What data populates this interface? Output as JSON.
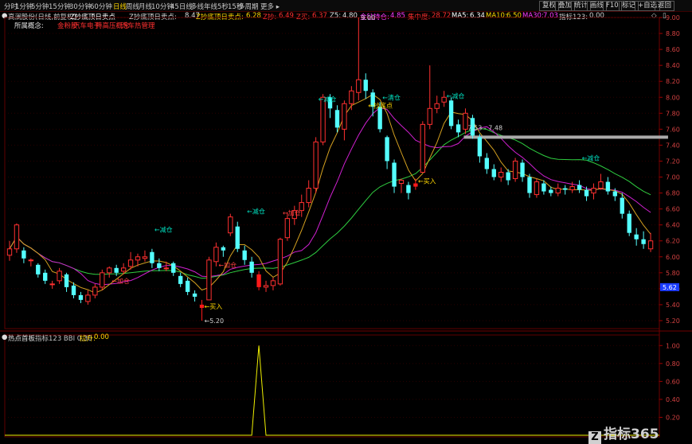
{
  "toolbar": {
    "tabs": [
      "分时",
      "1分钟",
      "5分钟",
      "15分钟",
      "30分钟",
      "60分钟",
      "日线",
      "周线",
      "月线",
      "10分钟",
      "45日线",
      "多线",
      "年线",
      "5秒",
      "15秒",
      "多周期",
      "更多 ▸"
    ],
    "active_index": 6,
    "right_buttons": [
      "复权",
      "叠加",
      "统计",
      "画线",
      "F10",
      "标记",
      "+自选",
      "返回"
    ]
  },
  "info": {
    "stock": "高澜股份(日线,前复权)",
    "indicator": "Z抄底顶日卖点",
    "v1_label": "Z抄底顶日卖点:",
    "v1": "8.47",
    "v2_label": "Z抄底顶日卖点:",
    "v2": "6.28",
    "v3_label": "Z抄:",
    "v3": "6.49",
    "v4_label": "Z买:",
    "v4": "6.37",
    "v5_label": "Z5:",
    "v5": "4.80",
    "v6_label": "金钻持仓:",
    "v6": "4.85",
    "v7_label": "集中度:",
    "v7": "28.72",
    "ma5_label": "MA5:",
    "ma5": "6.34",
    "ma10_label": "MA10:",
    "ma10": "6.50",
    "ma30_label": "MA30:",
    "ma30": "7.03",
    "sig_label": "指标123:",
    "sig": "0.00"
  },
  "tags": {
    "title": "所属概念:",
    "items": [
      "金粉股",
      "汽车电子",
      "特高压概念",
      "汽车热管理"
    ]
  },
  "indicator_panel": {
    "name": "热点首板",
    "params": "指标123 BBI 0.30",
    "param_label": "拉升:",
    "param_value": "0.00"
  },
  "watermark": "指标365",
  "chart_data": {
    "type": "candlestick",
    "y_ticks": [
      "9.00",
      "8.80",
      "8.60",
      "8.40",
      "8.20",
      "8.00",
      "7.80",
      "7.60",
      "7.40",
      "7.20",
      "7.00",
      "6.80",
      "6.60",
      "6.40",
      "6.20",
      "6.00",
      "5.80",
      "5.60",
      "5.40",
      "5.20"
    ],
    "ylim": [
      5.1,
      9.0
    ],
    "current_price": "5.62",
    "annotations": [
      {
        "text": "9.00",
        "i": 49,
        "price": 9.0
      },
      {
        "text": "←减仓",
        "i": 20,
        "price": 6.34
      },
      {
        "text": "←减仓",
        "i": 33,
        "price": 6.57
      },
      {
        "text": "←减仓",
        "i": 43,
        "price": 7.98
      },
      {
        "text": "←清仓",
        "i": 52,
        "price": 8.0
      },
      {
        "text": "←抄底点",
        "i": 50,
        "price": 7.9
      },
      {
        "text": "←减仓",
        "i": 61,
        "price": 8.02
      },
      {
        "text": "←减仓",
        "i": 80,
        "price": 7.24
      },
      {
        "text": "←加仓",
        "i": 29,
        "price": 5.9
      },
      {
        "text": "←加仓",
        "i": 38,
        "price": 6.55
      },
      {
        "text": "←加仓",
        "i": 14,
        "price": 5.7
      },
      {
        "text": "←买入",
        "i": 27,
        "price": 5.38
      },
      {
        "text": "←5.20",
        "i": 27,
        "price": 5.2
      },
      {
        "text": "←买入",
        "i": 57,
        "price": 6.95
      },
      {
        "text": "7.53 - 7.48",
        "i": 64,
        "price": 7.62
      }
    ],
    "candles": [
      {
        "o": 6.02,
        "c": 6.1,
        "h": 6.2,
        "l": 5.95
      },
      {
        "o": 6.1,
        "c": 6.4,
        "h": 6.42,
        "l": 6.05
      },
      {
        "o": 6.08,
        "c": 5.98,
        "h": 6.12,
        "l": 5.92
      },
      {
        "o": 5.96,
        "c": 5.96,
        "h": 5.98,
        "l": 5.88
      },
      {
        "o": 5.9,
        "c": 5.78,
        "h": 5.92,
        "l": 5.74
      },
      {
        "o": 5.8,
        "c": 5.7,
        "h": 5.84,
        "l": 5.66
      },
      {
        "o": 5.66,
        "c": 5.66,
        "h": 5.7,
        "l": 5.6
      },
      {
        "o": 5.7,
        "c": 5.82,
        "h": 5.86,
        "l": 5.66
      },
      {
        "o": 5.78,
        "c": 5.62,
        "h": 5.8,
        "l": 5.56
      },
      {
        "o": 5.64,
        "c": 5.52,
        "h": 5.68,
        "l": 5.48
      },
      {
        "o": 5.52,
        "c": 5.46,
        "h": 5.56,
        "l": 5.42
      },
      {
        "o": 5.44,
        "c": 5.52,
        "h": 5.58,
        "l": 5.4
      },
      {
        "o": 5.52,
        "c": 5.62,
        "h": 5.66,
        "l": 5.48
      },
      {
        "o": 5.62,
        "c": 5.8,
        "h": 5.84,
        "l": 5.58
      },
      {
        "o": 5.8,
        "c": 5.86,
        "h": 5.88,
        "l": 5.74
      },
      {
        "o": 5.86,
        "c": 5.8,
        "h": 5.9,
        "l": 5.76
      },
      {
        "o": 5.82,
        "c": 5.86,
        "h": 5.92,
        "l": 5.78
      },
      {
        "o": 5.88,
        "c": 5.96,
        "h": 6.06,
        "l": 5.84
      },
      {
        "o": 5.96,
        "c": 6.0,
        "h": 6.04,
        "l": 5.88
      },
      {
        "o": 5.98,
        "c": 6.0,
        "h": 6.08,
        "l": 5.94
      },
      {
        "o": 6.06,
        "c": 5.92,
        "h": 6.1,
        "l": 5.86
      },
      {
        "o": 5.92,
        "c": 5.86,
        "h": 5.98,
        "l": 5.82
      },
      {
        "o": 5.86,
        "c": 5.86,
        "h": 5.94,
        "l": 5.82
      },
      {
        "o": 5.92,
        "c": 5.8,
        "h": 5.94,
        "l": 5.76
      },
      {
        "o": 5.76,
        "c": 5.66,
        "h": 5.8,
        "l": 5.62
      },
      {
        "o": 5.7,
        "c": 5.56,
        "h": 5.74,
        "l": 5.52
      },
      {
        "o": 5.54,
        "c": 5.5,
        "h": 5.58,
        "l": 5.44
      },
      {
        "o": 5.36,
        "c": 5.4,
        "h": 5.46,
        "l": 5.2
      },
      {
        "o": 5.46,
        "c": 5.96,
        "h": 6.0,
        "l": 5.46
      },
      {
        "o": 5.94,
        "c": 6.12,
        "h": 6.18,
        "l": 5.88
      },
      {
        "o": 6.12,
        "c": 6.08,
        "h": 6.14,
        "l": 6.0
      },
      {
        "o": 6.3,
        "c": 6.5,
        "h": 6.54,
        "l": 6.26
      },
      {
        "o": 6.38,
        "c": 6.1,
        "h": 6.44,
        "l": 6.06
      },
      {
        "o": 6.08,
        "c": 5.96,
        "h": 6.14,
        "l": 5.9
      },
      {
        "o": 5.94,
        "c": 5.8,
        "h": 6.0,
        "l": 5.74
      },
      {
        "o": 5.78,
        "c": 5.62,
        "h": 5.82,
        "l": 5.58
      },
      {
        "o": 5.62,
        "c": 5.64,
        "h": 5.7,
        "l": 5.56
      },
      {
        "o": 5.64,
        "c": 5.7,
        "h": 5.74,
        "l": 5.58
      },
      {
        "o": 5.66,
        "c": 6.22,
        "h": 6.24,
        "l": 5.64
      },
      {
        "o": 6.24,
        "c": 6.48,
        "h": 6.56,
        "l": 6.2
      },
      {
        "o": 6.48,
        "c": 6.58,
        "h": 6.64,
        "l": 6.4
      },
      {
        "o": 6.58,
        "c": 6.68,
        "h": 6.78,
        "l": 6.5
      },
      {
        "o": 6.68,
        "c": 6.86,
        "h": 6.96,
        "l": 6.62
      },
      {
        "o": 6.86,
        "c": 7.44,
        "h": 7.5,
        "l": 6.8
      },
      {
        "o": 7.44,
        "c": 8.0,
        "h": 8.04,
        "l": 7.4
      },
      {
        "o": 8.0,
        "c": 7.86,
        "h": 8.04,
        "l": 7.74
      },
      {
        "o": 7.84,
        "c": 7.62,
        "h": 7.9,
        "l": 7.56
      },
      {
        "o": 7.6,
        "c": 7.92,
        "h": 7.96,
        "l": 7.46
      },
      {
        "o": 7.92,
        "c": 8.08,
        "h": 8.14,
        "l": 7.84
      },
      {
        "o": 8.06,
        "c": 8.22,
        "h": 9.0,
        "l": 7.96
      },
      {
        "o": 8.22,
        "c": 8.08,
        "h": 8.3,
        "l": 7.98
      },
      {
        "o": 8.06,
        "c": 7.88,
        "h": 8.1,
        "l": 7.76
      },
      {
        "o": 7.88,
        "c": 7.6,
        "h": 7.94,
        "l": 7.56
      },
      {
        "o": 7.5,
        "c": 7.2,
        "h": 7.52,
        "l": 7.1
      },
      {
        "o": 7.18,
        "c": 6.88,
        "h": 7.22,
        "l": 6.8
      },
      {
        "o": 6.92,
        "c": 6.96,
        "h": 6.98,
        "l": 6.8
      },
      {
        "o": 6.9,
        "c": 6.8,
        "h": 6.94,
        "l": 6.72
      },
      {
        "o": 6.88,
        "c": 6.92,
        "h": 6.98,
        "l": 6.84
      },
      {
        "o": 7.06,
        "c": 7.66,
        "h": 7.7,
        "l": 7.06
      },
      {
        "o": 7.66,
        "c": 7.86,
        "h": 8.4,
        "l": 7.6
      },
      {
        "o": 7.86,
        "c": 7.92,
        "h": 8.02,
        "l": 7.8
      },
      {
        "o": 7.94,
        "c": 8.0,
        "h": 8.08,
        "l": 7.88
      },
      {
        "o": 7.96,
        "c": 7.64,
        "h": 8.0,
        "l": 7.6
      },
      {
        "o": 7.66,
        "c": 7.56,
        "h": 7.72,
        "l": 7.5
      },
      {
        "o": 7.6,
        "c": 7.8,
        "h": 7.86,
        "l": 7.54
      },
      {
        "o": 7.74,
        "c": 7.52,
        "h": 7.78,
        "l": 7.48
      },
      {
        "o": 7.5,
        "c": 7.26,
        "h": 7.54,
        "l": 7.18
      },
      {
        "o": 7.24,
        "c": 7.1,
        "h": 7.3,
        "l": 7.04
      },
      {
        "o": 7.1,
        "c": 7.0,
        "h": 7.16,
        "l": 6.96
      },
      {
        "o": 7.0,
        "c": 7.06,
        "h": 7.12,
        "l": 6.94
      },
      {
        "o": 7.06,
        "c": 6.96,
        "h": 7.1,
        "l": 6.9
      },
      {
        "o": 6.98,
        "c": 7.2,
        "h": 7.24,
        "l": 6.94
      },
      {
        "o": 7.18,
        "c": 7.0,
        "h": 7.22,
        "l": 6.94
      },
      {
        "o": 7.0,
        "c": 6.8,
        "h": 7.04,
        "l": 6.74
      },
      {
        "o": 6.78,
        "c": 6.94,
        "h": 6.98,
        "l": 6.74
      },
      {
        "o": 6.92,
        "c": 6.82,
        "h": 6.96,
        "l": 6.78
      },
      {
        "o": 6.84,
        "c": 6.8,
        "h": 6.88,
        "l": 6.76
      },
      {
        "o": 6.8,
        "c": 6.86,
        "h": 6.92,
        "l": 6.76
      },
      {
        "o": 6.86,
        "c": 6.84,
        "h": 6.9,
        "l": 6.78
      },
      {
        "o": 6.84,
        "c": 6.88,
        "h": 6.94,
        "l": 6.8
      },
      {
        "o": 6.9,
        "c": 6.84,
        "h": 6.96,
        "l": 6.8
      },
      {
        "o": 6.84,
        "c": 6.76,
        "h": 6.88,
        "l": 6.7
      },
      {
        "o": 6.8,
        "c": 6.86,
        "h": 6.92,
        "l": 6.72
      },
      {
        "o": 6.86,
        "c": 6.94,
        "h": 7.04,
        "l": 6.84
      },
      {
        "o": 6.94,
        "c": 6.82,
        "h": 7.0,
        "l": 6.78
      },
      {
        "o": 6.82,
        "c": 6.76,
        "h": 6.86,
        "l": 6.7
      },
      {
        "o": 6.74,
        "c": 6.54,
        "h": 6.8,
        "l": 6.48
      },
      {
        "o": 6.54,
        "c": 6.3,
        "h": 6.58,
        "l": 6.26
      },
      {
        "o": 6.28,
        "c": 6.22,
        "h": 6.36,
        "l": 6.14
      },
      {
        "o": 6.22,
        "c": 6.16,
        "h": 6.32,
        "l": 6.1
      },
      {
        "o": 6.1,
        "c": 6.2,
        "h": 6.3,
        "l": 6.06
      }
    ],
    "red_indices": [
      27,
      35,
      57
    ],
    "resistance": {
      "from_i": 64,
      "to_i": 92,
      "price": 7.5
    },
    "indicator_series": {
      "ylim": [
        0,
        1.1
      ],
      "y_ticks": [
        "1.00",
        "0.80",
        "0.60",
        "0.40",
        "0.20"
      ],
      "spike_index": 35,
      "spike_value": 1.0
    }
  }
}
